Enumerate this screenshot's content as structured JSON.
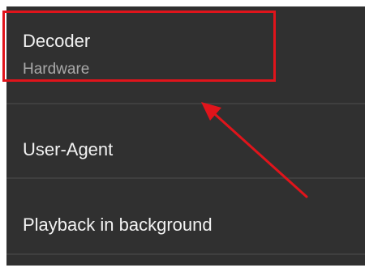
{
  "settings": {
    "items": [
      {
        "title": "Decoder",
        "subtitle": "Hardware"
      },
      {
        "title": "User-Agent"
      },
      {
        "title": "Playback in background"
      }
    ]
  },
  "annotation": {
    "color": "#e0141b"
  }
}
